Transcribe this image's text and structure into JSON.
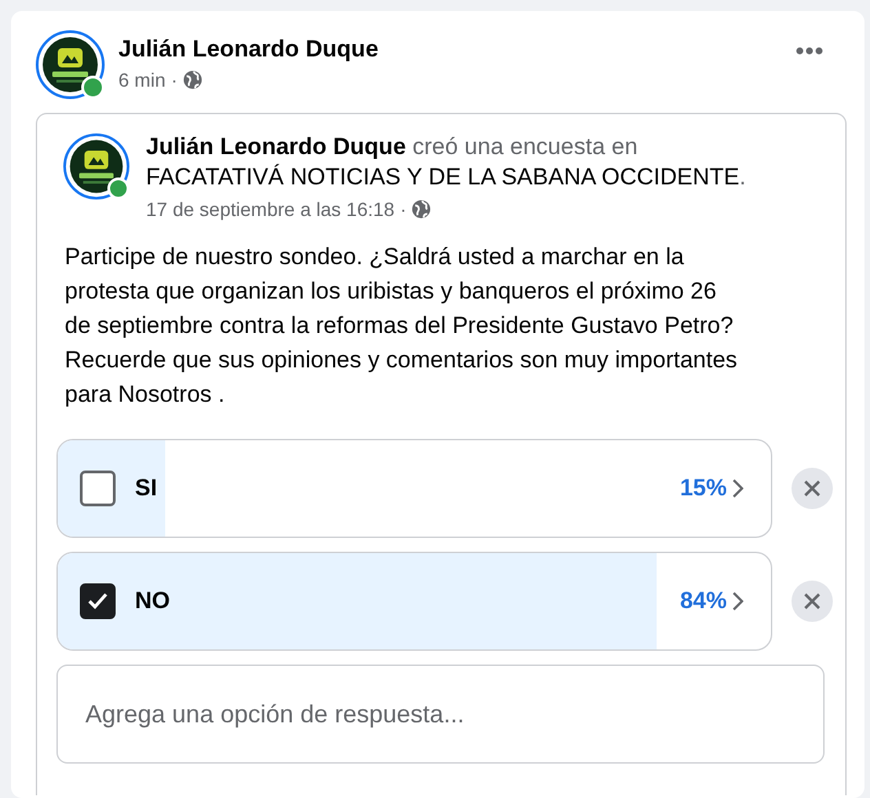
{
  "post": {
    "author": "Julián Leonardo Duque",
    "time": "6 min",
    "separator": "·",
    "online": true
  },
  "shared": {
    "author": "Julián Leonardo Duque",
    "action": "creó una encuesta en",
    "group": "FACATATIVÁ NOTICIAS Y DE LA SABANA OCCIDENTE",
    "group_end": ".",
    "date": "17 de septiembre a las 16:18",
    "separator": "·",
    "online": true,
    "text": "Participe de nuestro sondeo. ¿Saldrá usted a marchar en la protesta que organizan los uribistas y banqueros el próximo 26 de septiembre contra la reformas del Presidente Gustavo Petro? Recuerde que sus opiniones y comentarios son muy importantes para Nosotros ."
  },
  "poll": {
    "options": [
      {
        "label": "SI",
        "checked": false,
        "level": 0.15,
        "percent": "15%"
      },
      {
        "label": "NO",
        "checked": true,
        "level": 0.84,
        "percent": "84%"
      }
    ],
    "add_option": {
      "placeholder": "Agrega una opción de respuesta..."
    }
  }
}
